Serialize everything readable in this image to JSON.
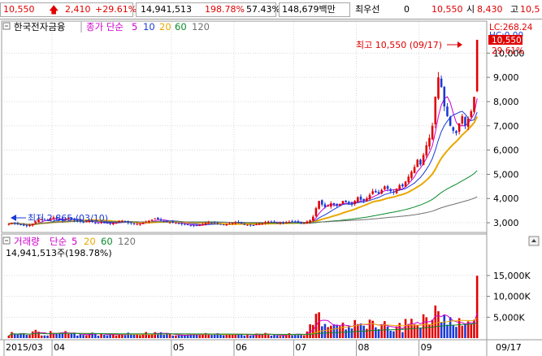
{
  "topbar": {
    "price": "10,550",
    "change": "2,410",
    "change_pct": "+29.61%",
    "volume": "14,941,513",
    "volume_ratio": "198.78%",
    "turnover_pct": "57.43%",
    "amount": "148,679백만",
    "priority_label": "최우선",
    "priority_value": "0",
    "ask": "10,550",
    "open_label": "시",
    "open_value": "8,430",
    "high_label": "고",
    "high_value": "10,5"
  },
  "price_panel": {
    "stock_name": "한국전자금융",
    "ma_label": "종가 단순",
    "ma_periods": [
      "5",
      "10",
      "20",
      "60",
      "120"
    ],
    "high_annotation": "최고 10,550 (09/17)",
    "low_annotation": "최저 2,865 (03/10)",
    "right_lc": "LC:268.24",
    "right_hc": "HC:0.00",
    "current_price_tag": "10,550",
    "current_pct_tag": "29.61%",
    "y_ticks": [
      "10,000",
      "9,000",
      "8,000",
      "7,000",
      "6,000",
      "5,000",
      "4,000",
      "3,000"
    ]
  },
  "volume_panel": {
    "title": "거래량",
    "ma_label": "단순",
    "ma_periods": [
      "5",
      "20",
      "60",
      "120"
    ],
    "current_volume": "14,941,513주(198.78%)",
    "y_ticks": [
      "15,000K",
      "10,000K",
      "5,000K"
    ]
  },
  "x_axis": {
    "labels": [
      "2015/03",
      "04",
      "05",
      "06",
      "07",
      "08",
      "09"
    ],
    "right_label": "09/17"
  },
  "colors": {
    "up": "#e00000",
    "down": "#1a3ad6",
    "ma5": "#cc00cc",
    "ma10": "#1a3ad6",
    "ma20": "#e8a800",
    "ma60": "#0a8a2a",
    "ma120": "#707070"
  },
  "chart_data": {
    "type": "candlestick",
    "x_start": "2015-03-03",
    "x_end": "2015-09-17",
    "y_range": [
      2700,
      10750
    ],
    "volume_range": [
      0,
      18500000
    ],
    "key_points": [
      {
        "date": "2015-03-10",
        "low": 2865
      },
      {
        "date": "2015-09-17",
        "high": 10550,
        "close": 10550,
        "volume": 14941513
      }
    ],
    "close_series": [
      2950,
      3000,
      2980,
      2950,
      2900,
      2880,
      2870,
      2900,
      2960,
      3050,
      3120,
      3140,
      3120,
      3100,
      3180,
      3220,
      3180,
      3120,
      3080,
      3150,
      3200,
      3160,
      3100,
      3080,
      3050,
      3030,
      3050,
      3080,
      3030,
      3000,
      2990,
      3020,
      3000,
      2980,
      2960,
      2990,
      3010,
      3060,
      3080,
      3050,
      3000,
      2980,
      2950,
      2940,
      2960,
      3000,
      3050,
      3080,
      3120,
      3180,
      3140,
      3080,
      3060,
      3030,
      3010,
      3000,
      2990,
      2970,
      2950,
      2930,
      2910,
      2880,
      2870,
      2890,
      2920,
      2950,
      2980,
      3010,
      3000,
      2980,
      2950,
      2930,
      2920,
      2940,
      2960,
      2990,
      3010,
      2990,
      2960,
      2940,
      2920,
      2910,
      2900,
      2930,
      2960,
      2980,
      3020,
      3050,
      3040,
      3020,
      3000,
      2990,
      2980,
      3010,
      3040,
      3060,
      3040,
      3010,
      2990,
      2980,
      3050,
      3100,
      3250,
      3600,
      3900,
      3750,
      3650,
      3700,
      3800,
      3750,
      3700,
      3780,
      3900,
      3850,
      3800,
      3750,
      3900,
      4050,
      3950,
      3900,
      4000,
      4150,
      4300,
      4250,
      4200,
      4350,
      4500,
      4400,
      4300,
      4250,
      4400,
      4550,
      4500,
      4700,
      4900,
      5100,
      5300,
      5600,
      5400,
      5800,
      6200,
      6500,
      7000,
      8200,
      9000,
      8600,
      7800,
      7400,
      7000,
      6800,
      6700,
      7100,
      7400,
      7000,
      7300,
      7600,
      8200,
      10550
    ]
  }
}
